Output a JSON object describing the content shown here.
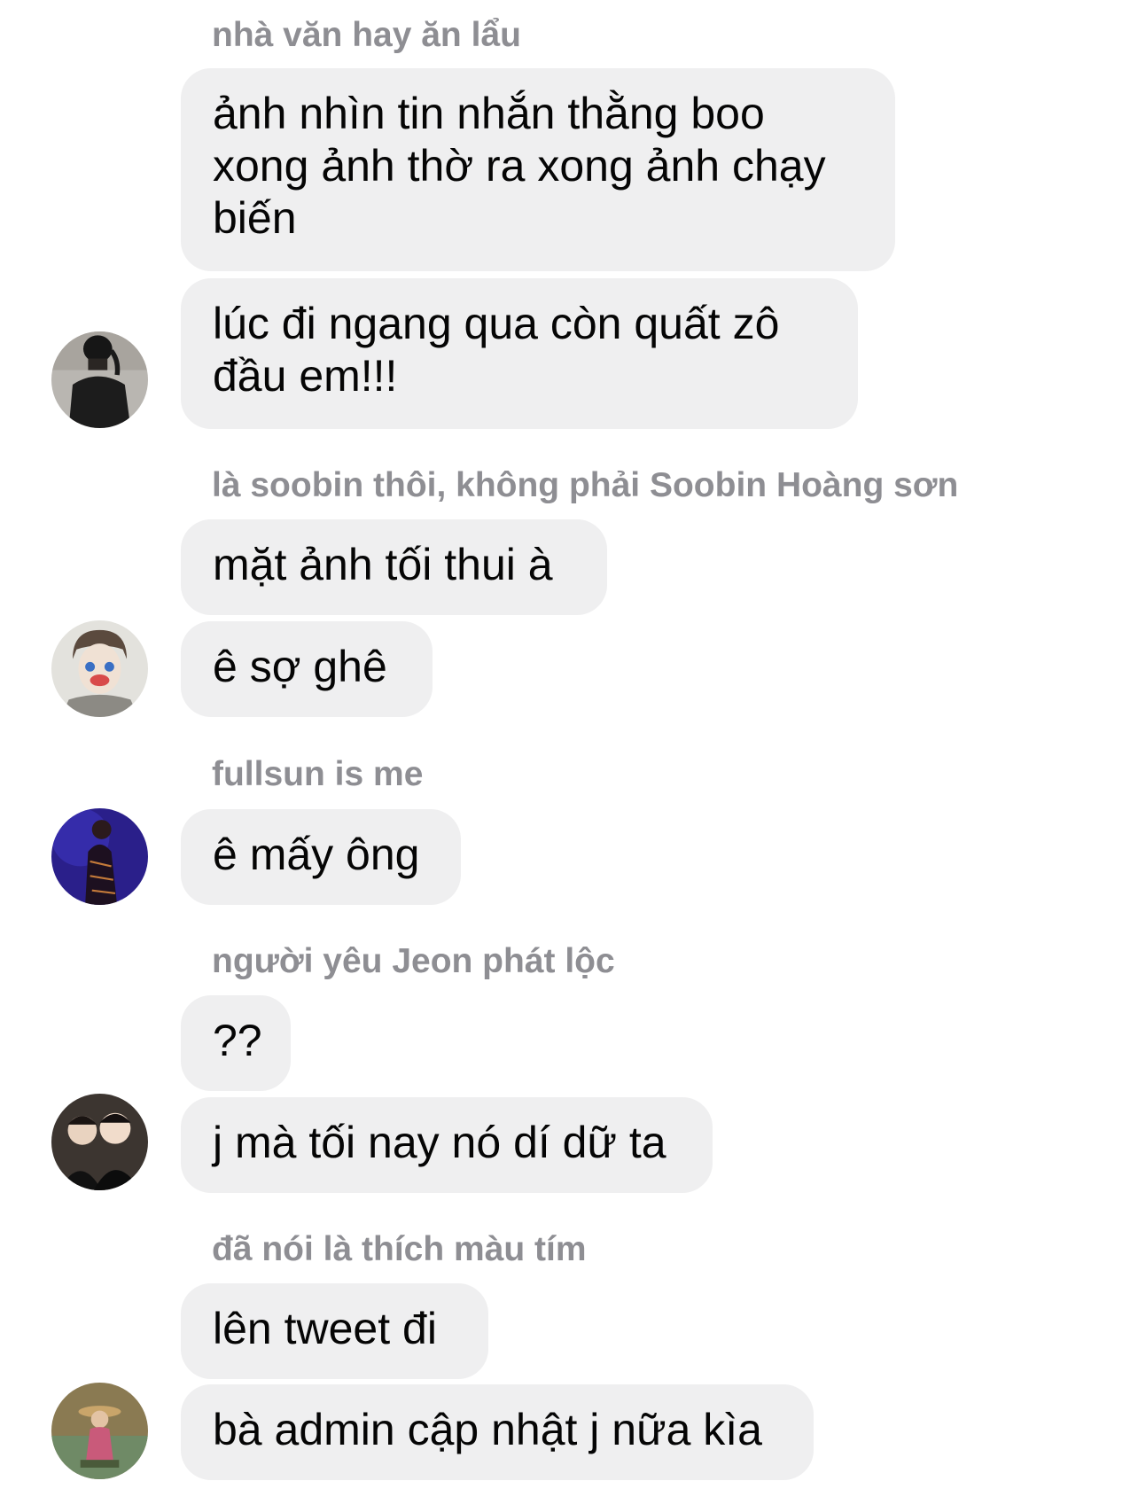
{
  "conversation": {
    "groups": [
      {
        "sender": "nhà văn hay ăn lẩu",
        "messages": [
          {
            "lines": [
              "ảnh nhìn tin nhắn thằng boo",
              "xong ảnh thờ ra xong ảnh chạy",
              "biến"
            ]
          },
          {
            "lines": [
              "lúc đi ngang qua còn quất zô",
              "đầu em!!!"
            ]
          }
        ],
        "avatar_icon": "avatar-dark-figure-icon"
      },
      {
        "sender": "là soobin thôi, không phải Soobin Hoàng sơn",
        "messages": [
          {
            "lines": [
              "mặt ảnh tối thui à"
            ]
          },
          {
            "lines": [
              "ê sợ ghê"
            ]
          }
        ],
        "avatar_icon": "avatar-face-paint-icon"
      },
      {
        "sender": "fullsun is me",
        "messages": [
          {
            "lines": [
              "ê mấy ông"
            ]
          }
        ],
        "avatar_icon": "avatar-stage-blue-icon"
      },
      {
        "sender": "người yêu Jeon phát lộc",
        "messages": [
          {
            "lines": [
              "??"
            ]
          },
          {
            "lines": [
              "j mà tối nay nó dí dữ ta"
            ]
          }
        ],
        "avatar_icon": "avatar-two-people-icon"
      },
      {
        "sender": "đã nói là thích màu tím",
        "messages": [
          {
            "lines": [
              "lên tweet đi"
            ]
          },
          {
            "lines": [
              "bà admin cập nhật j nữa kìa"
            ]
          }
        ],
        "avatar_icon": "avatar-outdoor-icon"
      }
    ]
  },
  "colors": {
    "bubble": "#efeff0",
    "sender_name": "#8e8e93",
    "message_text": "#050505",
    "background": "#ffffff"
  }
}
